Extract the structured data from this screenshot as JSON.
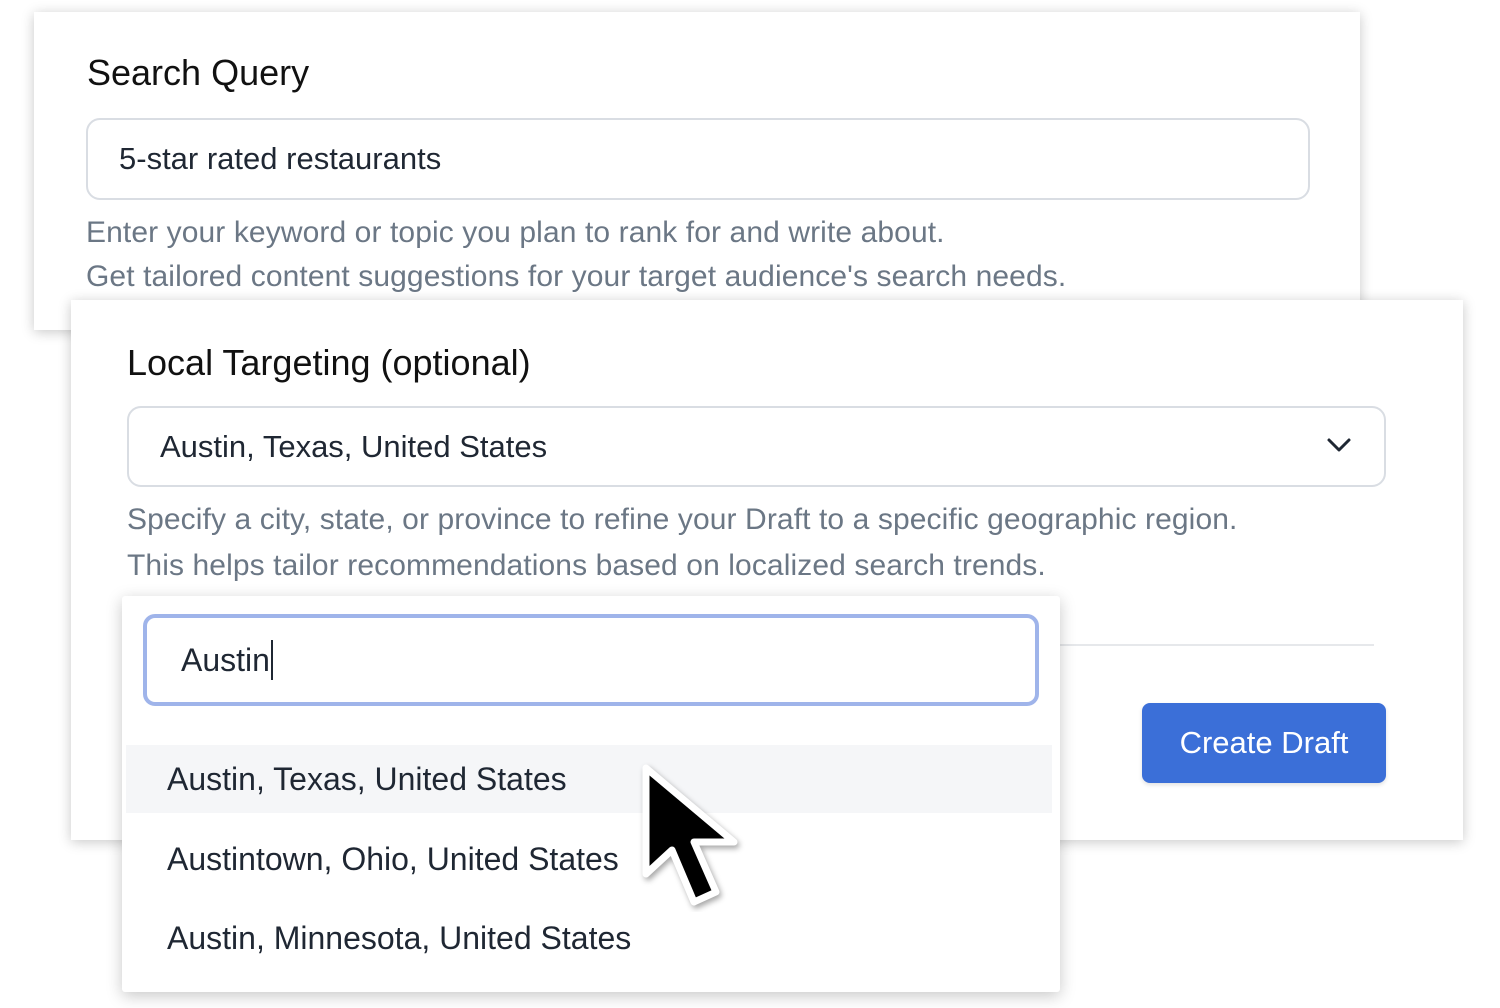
{
  "search_query": {
    "title": "Search Query",
    "value": "5-star rated restaurants",
    "help_line_1": "Enter your keyword or topic you plan to rank for and write about.",
    "help_line_2": "Get tailored content suggestions for your target audience's search needs."
  },
  "local_targeting": {
    "title": "Local Targeting (optional)",
    "selected_value": "Austin, Texas, United States",
    "chevron_icon": "chevron-down-icon",
    "help_line_1": "Specify a city, state, or province to refine your Draft to a specific geographic region.",
    "help_line_2": "This helps tailor recommendations based on localized search trends."
  },
  "dropdown": {
    "search_value": "Austin",
    "options": [
      "Austin, Texas, United States",
      "Austintown, Ohio, United States",
      "Austin, Minnesota, United States"
    ],
    "hovered_option": "Austin, Texas, United States"
  },
  "actions": {
    "create_draft_label": "Create Draft"
  },
  "colors": {
    "primary": "#3b6fd8",
    "focus_ring": "#9fb4ea",
    "help_text": "#6b7785",
    "hover_bg": "#f5f6f8"
  },
  "cursor_icon": "mouse-pointer-icon"
}
